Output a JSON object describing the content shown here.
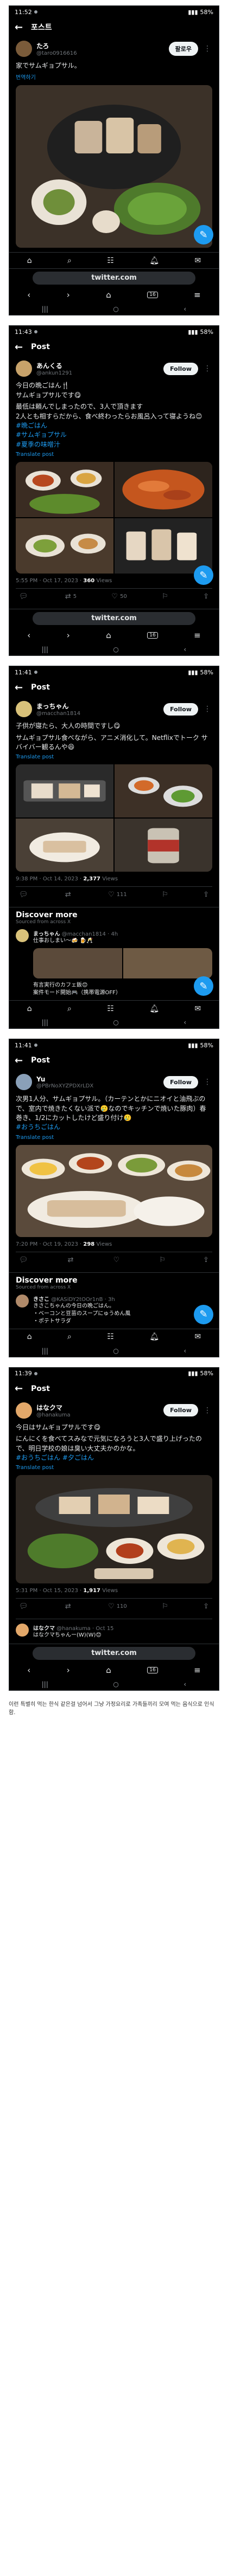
{
  "shots": [
    {
      "status": {
        "time": "11:52",
        "battery": "58%"
      },
      "header": {
        "title": "포스트"
      },
      "tweet": {
        "author_name": "たろ",
        "author_handle": "@taro0916616",
        "follow_label": "팔로우",
        "body": [
          "家でサムギョプサル。"
        ],
        "tags": [],
        "translate": "번역하기",
        "meta_date": "",
        "meta_count": "",
        "meta_suffix": "",
        "stats": {
          "replies": "",
          "retweets": "",
          "likes": ""
        }
      },
      "url": "twitter.com"
    },
    {
      "status": {
        "time": "11:43",
        "battery": "58%"
      },
      "header": {
        "title": "Post"
      },
      "tweet": {
        "author_name": "あんくる",
        "author_handle": "@ankun1291",
        "follow_label": "Follow",
        "body": [
          "今日の晩ごはん🍴",
          "サムギョプサルです😋",
          "",
          "最低は頼んでしまったので、3人で頂きます",
          "2人とも相すらだから、食べ終わったらお風呂入って寝ようね😊"
        ],
        "tags": [
          "#晩ごはん",
          "#サムギョプサル",
          "#夏季の味噌汁"
        ],
        "translate": "Translate post",
        "meta_date": "5:55 PM · Oct 17, 2023 · ",
        "meta_count": "360",
        "meta_suffix": " Views",
        "stats": {
          "replies": "",
          "retweets": "5",
          "likes": "50"
        }
      },
      "url": "twitter.com"
    },
    {
      "status": {
        "time": "11:41",
        "battery": "58%"
      },
      "header": {
        "title": "Post"
      },
      "tweet": {
        "author_name": "まっちゃん",
        "author_handle": "@macchan1814",
        "follow_label": "Follow",
        "body": [
          "子供が寝たら、大人の時間ですし😋",
          "",
          "サムギョプサル食べながら、アニメ消化して。Netflixでトーク サバイバー観るんや😆"
        ],
        "tags": [],
        "translate": "Translate post",
        "meta_date": "9:38 PM · Oct 14, 2023 · ",
        "meta_count": "2,377",
        "meta_suffix": " Views",
        "stats": {
          "replies": "",
          "retweets": "",
          "likes": "111"
        }
      },
      "discover": {
        "title": "Discover more",
        "subtitle": "Sourced from across X",
        "items": [
          {
            "name": "まっちゃん",
            "handle": "@macchan1814 · 4h",
            "text": "仕事おしまい〜🍻 🍺🥂"
          },
          {
            "name": "",
            "handle": "",
            "text": "有言実行のカフェ飯😊"
          },
          {
            "name": "",
            "handle": "",
            "text": "案件モード開始🎮（携帯電源OFF）"
          }
        ]
      }
    },
    {
      "status": {
        "time": "11:41",
        "battery": "58%"
      },
      "header": {
        "title": "Post"
      },
      "tweet": {
        "author_name": "Yu",
        "author_handle": "@PBrNoXYZPDXrLDX",
        "follow_label": "Follow",
        "body": [
          "次男1人分、サムギョプサル。（カーテンとかにニオイと油飛ぶので、室内で焼きたくない派で🥲なのでキッチンで焼いた豚肉）春巻き、1/2にカットしたけど盛り付け🥲"
        ],
        "tags": [
          "#おうちごはん"
        ],
        "translate": "Translate post",
        "meta_date": "7:20 PM · Oct 19, 2023 · ",
        "meta_count": "298",
        "meta_suffix": " Views",
        "stats": {
          "replies": "",
          "retweets": "",
          "likes": ""
        }
      },
      "discover": {
        "title": "Discover more",
        "subtitle": "Sourced from across X",
        "items": [
          {
            "name": "きさこ",
            "handle": "@KASiDY2tOOr1nB · 3h",
            "text": "きさこちゃんの今日の晩ごはん。\n・ベーコンと豆苗のスープにゅうめん風\n・ポテトサラダ"
          }
        ]
      }
    },
    {
      "status": {
        "time": "11:39",
        "battery": "58%"
      },
      "header": {
        "title": "Post"
      },
      "tweet": {
        "author_name": "はなクマ",
        "author_handle": "@hanakuma",
        "follow_label": "Follow",
        "body": [
          "今日はサムギョプサルです😋",
          "",
          "にんにくを食べてスみなで元気になろうと3人で盛り上げったので、明日学校の娘は臭い大丈夫かのかな。"
        ],
        "tags": [
          "#おうちごはん",
          "#夕ごはん"
        ],
        "translate": "Translate post",
        "meta_date": "5:31 PM · Oct 15, 2023 · ",
        "meta_count": "1,917",
        "meta_suffix": " Views",
        "stats": {
          "replies": "",
          "retweets": "",
          "likes": "110"
        }
      },
      "reply": {
        "name": "はなクマ",
        "handle": "@hanakuma · Oct 15",
        "text": "はなクマちゃんー(W)(W)😊"
      },
      "url": "twitter.com"
    }
  ],
  "caption": "이런 특별히 먹는 한식 같은걸 넘어서 그냥 가정요리로 가족들끼리 모여 먹는 음식으로 인식함."
}
